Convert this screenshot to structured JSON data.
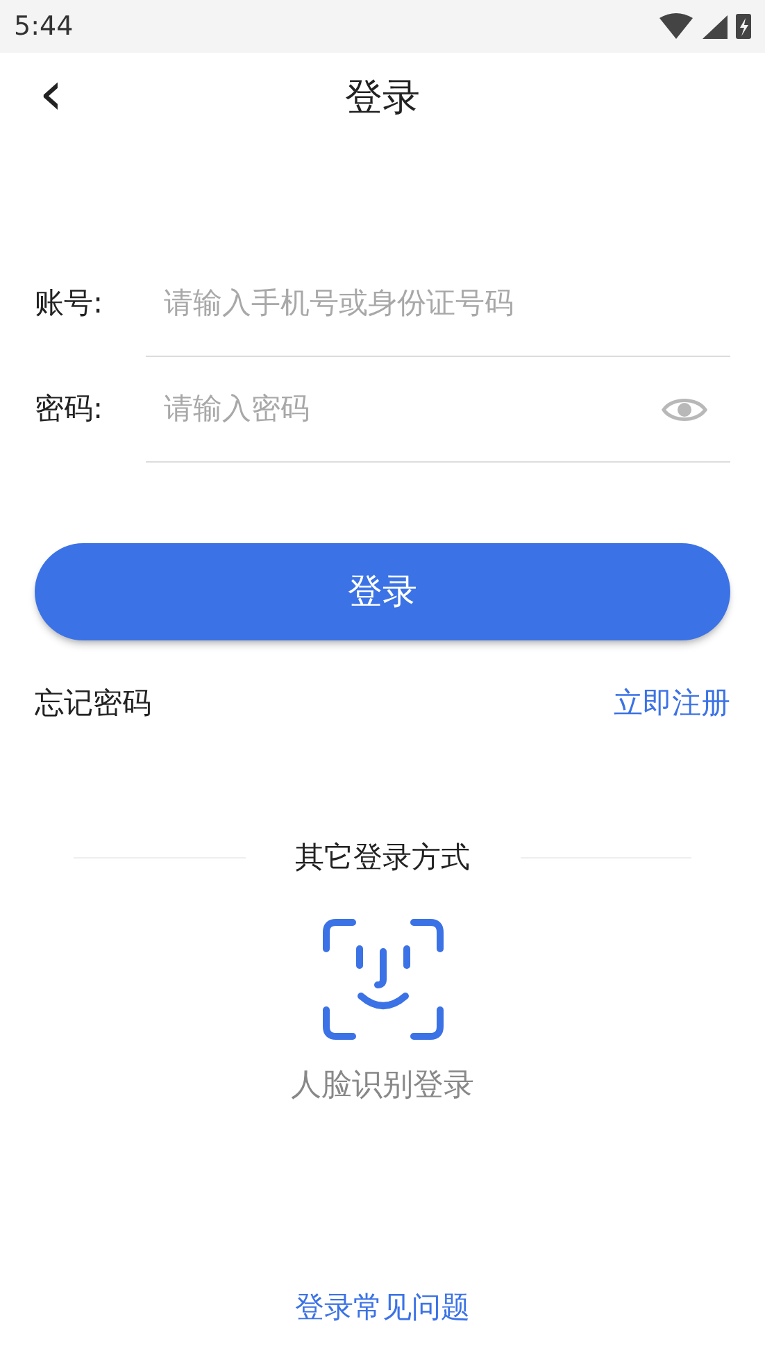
{
  "status_bar": {
    "time": "5:44"
  },
  "header": {
    "back": "‹",
    "title": "登录"
  },
  "fields": [
    {
      "label": "账号:",
      "placeholder": "请输入手机号或身份证号码",
      "kind": "text"
    },
    {
      "label": "密码:",
      "placeholder": "请输入密码",
      "kind": "password"
    }
  ],
  "login_button": "登录",
  "forgot_password": "忘记密码",
  "register": "立即注册",
  "other_methods": {
    "title": "其它登录方式",
    "face_login": "人脸识别登录"
  },
  "help_link": "登录常见问题"
}
